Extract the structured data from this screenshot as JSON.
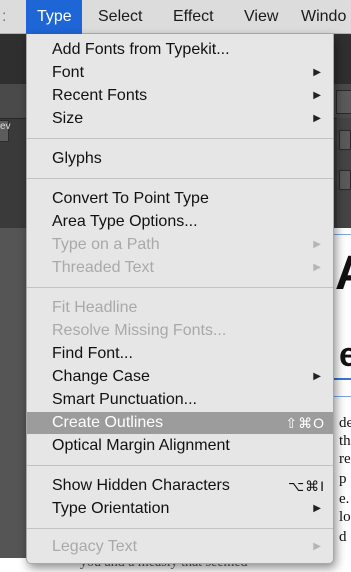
{
  "menubar": {
    "items": [
      {
        "label": ":"
      },
      {
        "label": "Type"
      },
      {
        "label": "Select"
      },
      {
        "label": "Effect"
      },
      {
        "label": "View"
      },
      {
        "label": "Windo"
      }
    ]
  },
  "menu": {
    "items": [
      {
        "label": "Add Fonts from Typekit...",
        "enabled": true
      },
      {
        "label": "Font",
        "enabled": true,
        "submenu": true
      },
      {
        "label": "Recent Fonts",
        "enabled": true,
        "submenu": true
      },
      {
        "label": "Size",
        "enabled": true,
        "submenu": true
      },
      {
        "label": "Glyphs",
        "enabled": true
      },
      {
        "label": "Convert To Point Type",
        "enabled": true
      },
      {
        "label": "Area Type Options...",
        "enabled": true
      },
      {
        "label": "Type on a Path",
        "enabled": false,
        "submenu": true
      },
      {
        "label": "Threaded Text",
        "enabled": false,
        "submenu": true
      },
      {
        "label": "Fit Headline",
        "enabled": false
      },
      {
        "label": "Resolve Missing Fonts...",
        "enabled": false
      },
      {
        "label": "Find Font...",
        "enabled": true
      },
      {
        "label": "Change Case",
        "enabled": true,
        "submenu": true
      },
      {
        "label": "Smart Punctuation...",
        "enabled": true
      },
      {
        "label": "Create Outlines",
        "enabled": true,
        "highlighted": true,
        "shortcut": "⇧⌘O"
      },
      {
        "label": "Optical Margin Alignment",
        "enabled": true
      },
      {
        "label": "Show Hidden Characters",
        "enabled": true,
        "shortcut": "⌥⌘I"
      },
      {
        "label": "Type Orientation",
        "enabled": true,
        "submenu": true
      },
      {
        "label": "Legacy Text",
        "enabled": false,
        "submenu": true
      }
    ]
  },
  "background": {
    "left_tab": "ev",
    "doc_big_letter_1": "A",
    "doc_big_letter_2": "e",
    "doc_text_lines": [
      "de",
      "th",
      "re",
      "p",
      "e.",
      "lo",
      "d"
    ],
    "bottom_text": "you and a measly that seemed"
  },
  "icons": {
    "submenu_arrow": "triangle-right-icon"
  },
  "colors": {
    "menubar_active": "#1e66d6",
    "menu_bg": "#e6e6e6",
    "highlight": "#9c9c9c",
    "disabled_text": "#a9a9a9"
  }
}
